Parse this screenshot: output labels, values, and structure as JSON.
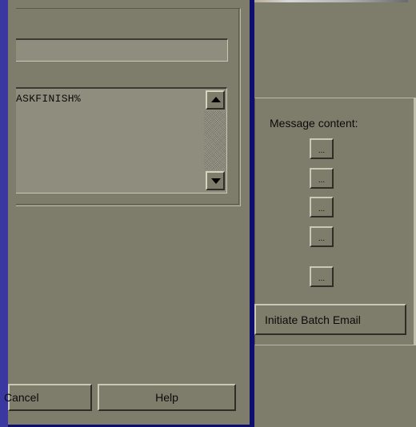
{
  "dialog": {
    "body_text": "ASKFINISH%",
    "subject_value": "",
    "buttons": {
      "cancel": "Cancel",
      "help": "Help"
    }
  },
  "right_panel": {
    "message_content_label": "Message content:",
    "insert_buttons": [
      "...",
      "...",
      "...",
      "...",
      "..."
    ],
    "batch_button": "Initiate Batch Email"
  },
  "colors": {
    "background": "#7e7d6c",
    "window_border": "#0e0e6e",
    "left_edge": "#3a38a0"
  }
}
